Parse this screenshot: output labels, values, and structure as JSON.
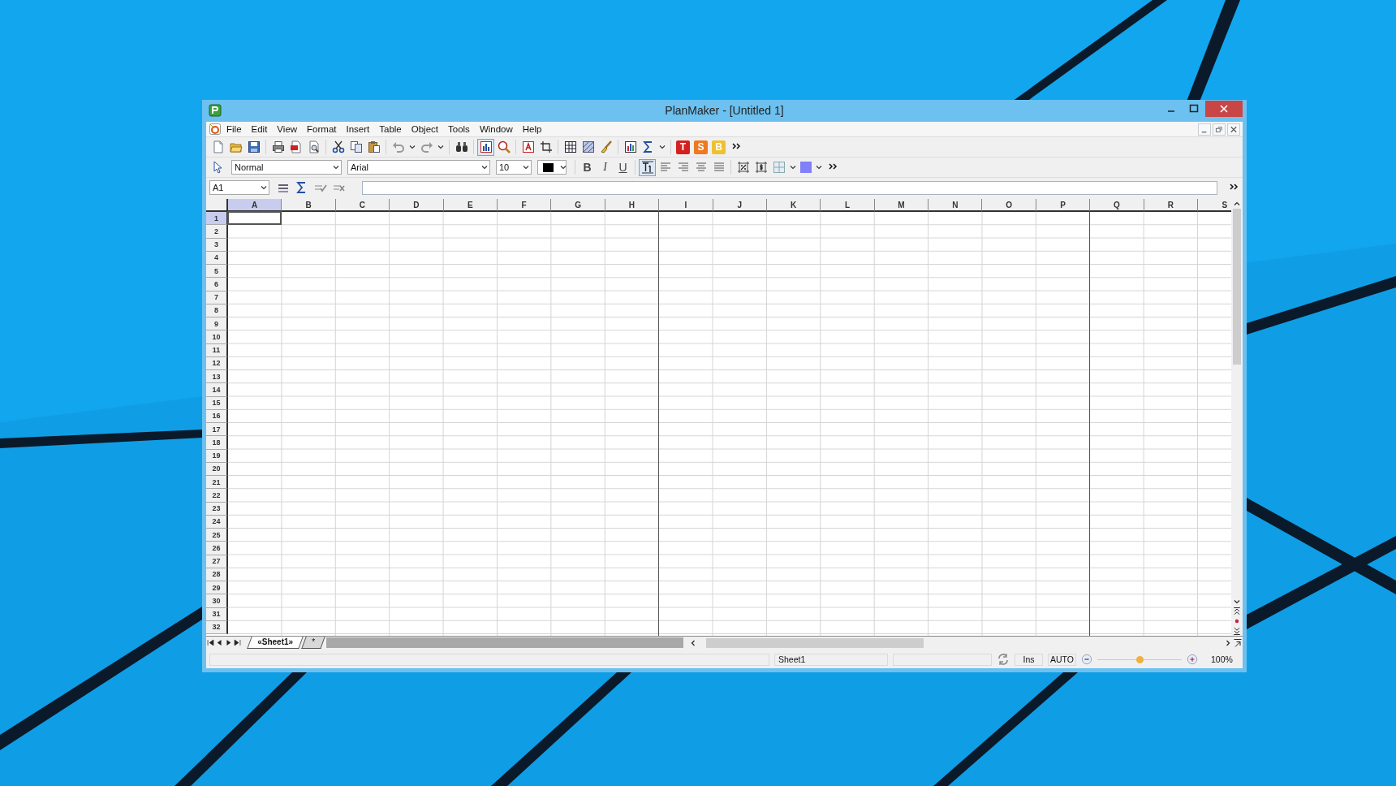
{
  "window": {
    "title": "PlanMaker - [Untitled 1]"
  },
  "menu": [
    "File",
    "Edit",
    "View",
    "Format",
    "Insert",
    "Table",
    "Object",
    "Tools",
    "Window",
    "Help"
  ],
  "launchers": [
    {
      "label": "T",
      "color": "#d42020"
    },
    {
      "label": "S",
      "color": "#f07820"
    },
    {
      "label": "B",
      "color": "#f0c030"
    }
  ],
  "format_bar": {
    "style": "Normal",
    "font": "Arial",
    "size": "10",
    "bold": "B",
    "italic": "I",
    "underline": "U"
  },
  "formula_bar": {
    "cell_reference": "A1"
  },
  "columns": [
    {
      "label": "A",
      "selected": true
    },
    {
      "label": "B",
      "selected": false
    },
    {
      "label": "C",
      "selected": false
    },
    {
      "label": "D",
      "selected": false
    },
    {
      "label": "E",
      "selected": false
    },
    {
      "label": "F",
      "selected": false
    },
    {
      "label": "G",
      "selected": false
    },
    {
      "label": "H",
      "selected": false,
      "page_break": true
    },
    {
      "label": "I",
      "selected": false
    },
    {
      "label": "J",
      "selected": false
    },
    {
      "label": "K",
      "selected": false
    },
    {
      "label": "L",
      "selected": false
    },
    {
      "label": "M",
      "selected": false
    },
    {
      "label": "N",
      "selected": false
    },
    {
      "label": "O",
      "selected": false
    },
    {
      "label": "P",
      "selected": false,
      "page_break": true
    },
    {
      "label": "Q",
      "selected": false
    },
    {
      "label": "R",
      "selected": false
    },
    {
      "label": "S",
      "selected": false
    }
  ],
  "rows": [
    {
      "label": "1",
      "selected": true
    },
    {
      "label": "2",
      "selected": false
    },
    {
      "label": "3",
      "selected": false
    },
    {
      "label": "4",
      "selected": false
    },
    {
      "label": "5",
      "selected": false
    },
    {
      "label": "6",
      "selected": false
    },
    {
      "label": "7",
      "selected": false
    },
    {
      "label": "8",
      "selected": false
    },
    {
      "label": "9",
      "selected": false
    },
    {
      "label": "10",
      "selected": false
    },
    {
      "label": "11",
      "selected": false
    },
    {
      "label": "12",
      "selected": false
    },
    {
      "label": "13",
      "selected": false
    },
    {
      "label": "14",
      "selected": false
    },
    {
      "label": "15",
      "selected": false
    },
    {
      "label": "16",
      "selected": false
    },
    {
      "label": "17",
      "selected": false
    },
    {
      "label": "18",
      "selected": false
    },
    {
      "label": "19",
      "selected": false
    },
    {
      "label": "20",
      "selected": false
    },
    {
      "label": "21",
      "selected": false
    },
    {
      "label": "22",
      "selected": false
    },
    {
      "label": "23",
      "selected": false
    },
    {
      "label": "24",
      "selected": false
    },
    {
      "label": "25",
      "selected": false
    },
    {
      "label": "26",
      "selected": false
    },
    {
      "label": "27",
      "selected": false
    },
    {
      "label": "28",
      "selected": false
    },
    {
      "label": "29",
      "selected": false
    },
    {
      "label": "30",
      "selected": false
    },
    {
      "label": "31",
      "selected": false
    },
    {
      "label": "32",
      "selected": false
    }
  ],
  "sheet_tabs": [
    {
      "label": "«Sheet1»",
      "selected": true
    },
    {
      "label": "*",
      "selected": false
    }
  ],
  "status_bar": {
    "sheet": "Sheet1",
    "mode": "Ins",
    "calculation": "AUTO",
    "zoom": {
      "level": 0.5
    },
    "zoom_reading": "100%"
  }
}
